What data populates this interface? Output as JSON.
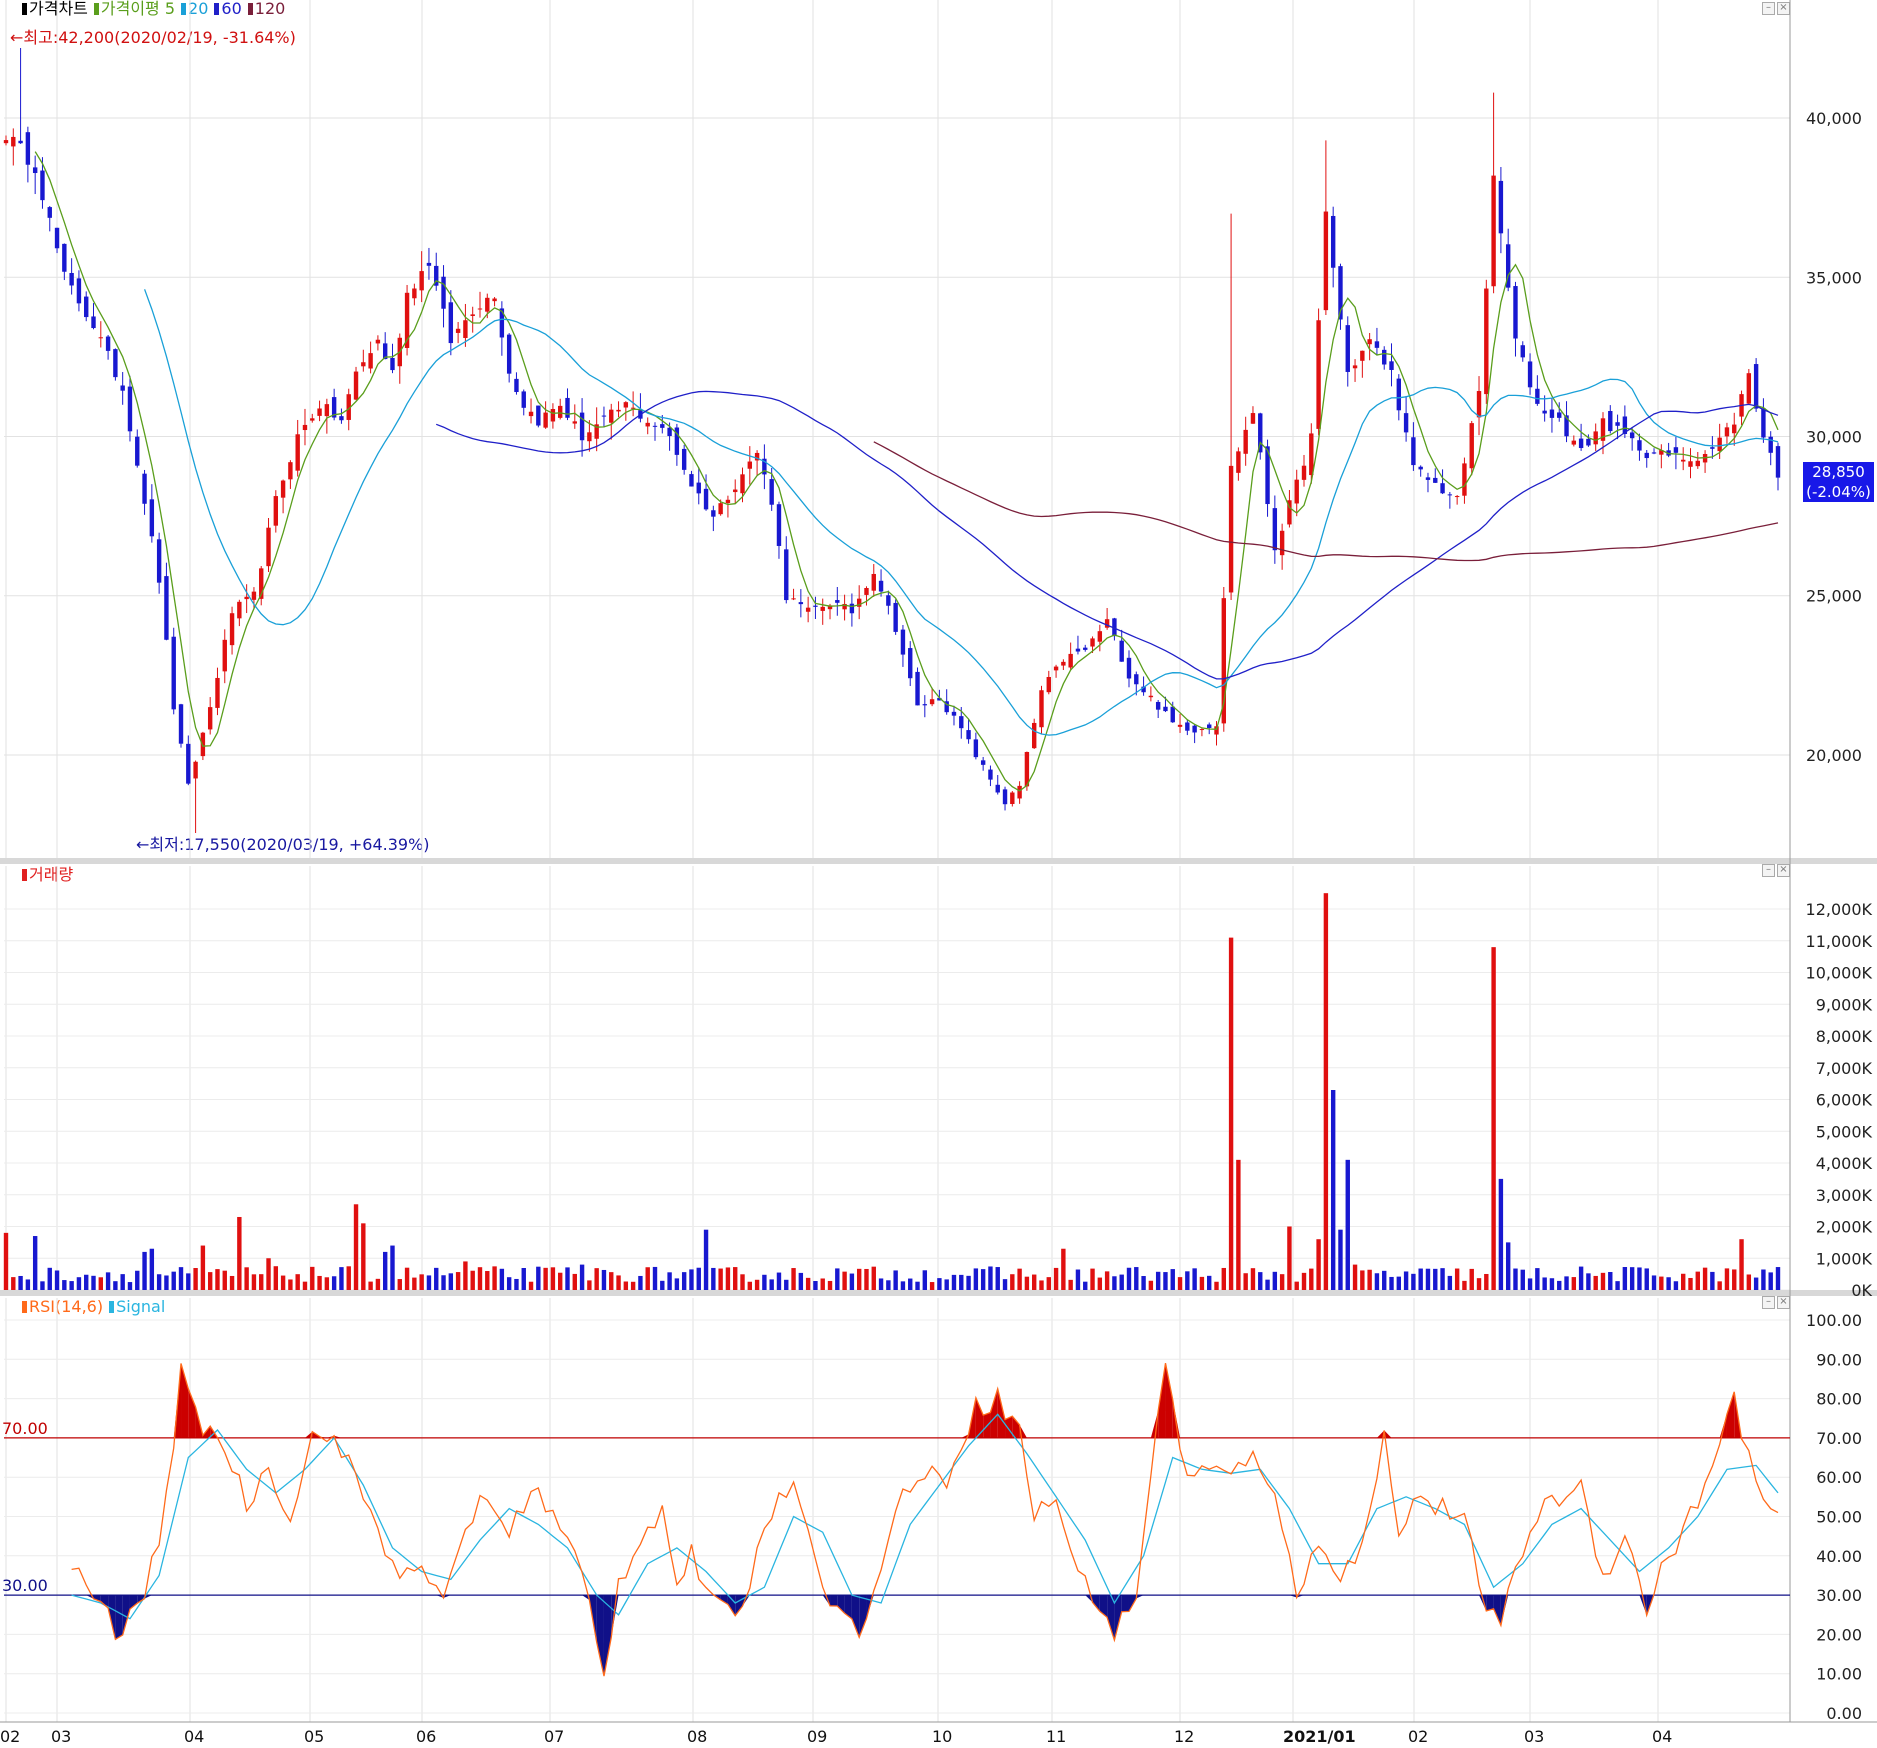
{
  "chart_data": [
    {
      "type": "candlestick",
      "panel": "price",
      "legend": [
        {
          "label": "가격차트",
          "color": "#000000"
        },
        {
          "label": "가격이평 5",
          "color": "#5a9e1c"
        },
        {
          "label": "20",
          "color": "#1aa0d8"
        },
        {
          "label": "60",
          "color": "#2020c8"
        },
        {
          "label": "120",
          "color": "#7a1f3a"
        }
      ],
      "high_note": "←최고:42,200(2020/02/19, -31.64%)",
      "low_note": "←최저:17,550(2020/03/19, +64.39%)",
      "current_price": "28,850",
      "current_change": "(-2.04%)",
      "y_ticks": [
        "40,000",
        "35,000",
        "30,000",
        "25,000",
        "20,000"
      ],
      "y_tick_values": [
        40000,
        35000,
        30000,
        25000,
        20000
      ],
      "ylim": [
        17000,
        42500
      ],
      "x_month_labels": [
        "02",
        "03",
        "04",
        "05",
        "06",
        "07",
        "08",
        "09",
        "10",
        "11",
        "12",
        "2021/01",
        "02",
        "03",
        "04"
      ],
      "close_anchors": [
        [
          0,
          39500
        ],
        [
          4,
          38500
        ],
        [
          8,
          35000
        ],
        [
          12,
          33500
        ],
        [
          16,
          31500
        ],
        [
          19,
          28000
        ],
        [
          21,
          25500
        ],
        [
          23,
          21500
        ],
        [
          25,
          19000
        ],
        [
          28,
          21500
        ],
        [
          31,
          24500
        ],
        [
          34,
          25000
        ],
        [
          37,
          28000
        ],
        [
          40,
          30000
        ],
        [
          43,
          31000
        ],
        [
          46,
          30500
        ],
        [
          48,
          32000
        ],
        [
          51,
          33000
        ],
        [
          53,
          32000
        ],
        [
          55,
          34500
        ],
        [
          58,
          35500
        ],
        [
          61,
          33000
        ],
        [
          64,
          34000
        ],
        [
          67,
          34500
        ],
        [
          69,
          32000
        ],
        [
          71,
          31000
        ],
        [
          73,
          30500
        ],
        [
          76,
          31000
        ],
        [
          79,
          30000
        ],
        [
          82,
          30500
        ],
        [
          85,
          31000
        ],
        [
          88,
          30500
        ],
        [
          91,
          30000
        ],
        [
          94,
          28500
        ],
        [
          97,
          27500
        ],
        [
          100,
          28500
        ],
        [
          103,
          29500
        ],
        [
          105,
          28000
        ],
        [
          107,
          25000
        ],
        [
          110,
          24500
        ],
        [
          113,
          24800
        ],
        [
          116,
          24500
        ],
        [
          119,
          25800
        ],
        [
          122,
          24000
        ],
        [
          125,
          21500
        ],
        [
          128,
          21800
        ],
        [
          131,
          20800
        ],
        [
          134,
          19600
        ],
        [
          137,
          18500
        ],
        [
          139,
          19000
        ],
        [
          142,
          22000
        ],
        [
          145,
          23000
        ],
        [
          148,
          23300
        ],
        [
          151,
          24200
        ],
        [
          154,
          22500
        ],
        [
          157,
          21800
        ],
        [
          160,
          21000
        ],
        [
          163,
          20800
        ],
        [
          166,
          21000
        ],
        [
          168,
          29000
        ],
        [
          171,
          30800
        ],
        [
          174,
          26500
        ],
        [
          177,
          28500
        ],
        [
          179,
          30000
        ],
        [
          181,
          37000
        ],
        [
          184,
          32000
        ],
        [
          187,
          33000
        ],
        [
          190,
          32000
        ],
        [
          193,
          29000
        ],
        [
          196,
          28500
        ],
        [
          199,
          28000
        ],
        [
          202,
          31500
        ],
        [
          204,
          38000
        ],
        [
          207,
          33000
        ],
        [
          210,
          31000
        ],
        [
          213,
          30500
        ],
        [
          216,
          29500
        ],
        [
          219,
          30500
        ],
        [
          222,
          30000
        ],
        [
          225,
          29500
        ],
        [
          228,
          29400
        ],
        [
          231,
          29300
        ],
        [
          234,
          29600
        ],
        [
          237,
          30500
        ],
        [
          239,
          32000
        ],
        [
          241,
          30000
        ],
        [
          243,
          28850
        ]
      ],
      "ma_periods": [
        5,
        20,
        60,
        120
      ]
    },
    {
      "type": "bar",
      "panel": "volume",
      "legend": [
        {
          "label": "거래량",
          "color": "#e02020"
        }
      ],
      "y_ticks": [
        "12,000K",
        "11,000K",
        "10,000K",
        "9,000K",
        "8,000K",
        "7,000K",
        "6,000K",
        "5,000K",
        "4,000K",
        "3,000K",
        "2,000K",
        "1,000K",
        "0K"
      ],
      "ylim": [
        0,
        12600
      ],
      "spikes": [
        [
          0,
          1800
        ],
        [
          4,
          1700
        ],
        [
          19,
          1200
        ],
        [
          20,
          1300
        ],
        [
          27,
          1400
        ],
        [
          32,
          2300
        ],
        [
          36,
          1000
        ],
        [
          48,
          2700
        ],
        [
          49,
          2100
        ],
        [
          52,
          1200
        ],
        [
          53,
          1400
        ],
        [
          63,
          900
        ],
        [
          79,
          800
        ],
        [
          96,
          1900
        ],
        [
          145,
          1300
        ],
        [
          168,
          11100
        ],
        [
          169,
          4100
        ],
        [
          176,
          2000
        ],
        [
          180,
          1600
        ],
        [
          181,
          12500
        ],
        [
          182,
          6300
        ],
        [
          183,
          1900
        ],
        [
          184,
          4100
        ],
        [
          185,
          800
        ],
        [
          204,
          10800
        ],
        [
          205,
          3500
        ],
        [
          206,
          1500
        ],
        [
          238,
          1600
        ]
      ]
    },
    {
      "type": "line",
      "panel": "rsi",
      "legend": [
        {
          "label": "RSI(14,6)",
          "color": "#ff6a1a"
        },
        {
          "label": "Signal",
          "color": "#2ab5e0"
        }
      ],
      "y_ticks": [
        "100.00",
        "90.00",
        "80.00",
        "70.00",
        "60.00",
        "50.00",
        "40.00",
        "30.00",
        "20.00",
        "10.00",
        "0.00"
      ],
      "ylim": [
        0,
        100
      ],
      "upper_level": "70.00",
      "lower_level": "30.00",
      "rsi_anchors": [
        [
          0,
          38
        ],
        [
          2,
          33
        ],
        [
          4,
          28
        ],
        [
          6,
          20
        ],
        [
          8,
          24
        ],
        [
          10,
          30
        ],
        [
          12,
          45
        ],
        [
          14,
          70
        ],
        [
          15,
          86
        ],
        [
          17,
          75
        ],
        [
          19,
          72
        ],
        [
          21,
          68
        ],
        [
          24,
          53
        ],
        [
          27,
          63
        ],
        [
          30,
          50
        ],
        [
          33,
          70
        ],
        [
          35,
          72
        ],
        [
          38,
          63
        ],
        [
          41,
          52
        ],
        [
          43,
          40
        ],
        [
          45,
          37
        ],
        [
          47,
          38
        ],
        [
          49,
          32
        ],
        [
          51,
          28
        ],
        [
          54,
          48
        ],
        [
          57,
          55
        ],
        [
          60,
          45
        ],
        [
          63,
          58
        ],
        [
          66,
          50
        ],
        [
          69,
          40
        ],
        [
          71,
          28
        ],
        [
          72,
          17
        ],
        [
          73,
          10
        ],
        [
          75,
          33
        ],
        [
          78,
          45
        ],
        [
          81,
          52
        ],
        [
          83,
          33
        ],
        [
          85,
          40
        ],
        [
          88,
          28
        ],
        [
          91,
          23
        ],
        [
          94,
          40
        ],
        [
          97,
          58
        ],
        [
          100,
          55
        ],
        [
          102,
          40
        ],
        [
          105,
          25
        ],
        [
          108,
          22
        ],
        [
          111,
          35
        ],
        [
          114,
          58
        ],
        [
          117,
          60
        ],
        [
          120,
          60
        ],
        [
          124,
          78
        ],
        [
          127,
          80
        ],
        [
          130,
          72
        ],
        [
          132,
          50
        ],
        [
          135,
          55
        ],
        [
          138,
          35
        ],
        [
          141,
          28
        ],
        [
          143,
          20
        ],
        [
          146,
          30
        ],
        [
          148,
          62
        ],
        [
          150,
          88
        ],
        [
          153,
          60
        ],
        [
          156,
          62
        ],
        [
          159,
          60
        ],
        [
          162,
          65
        ],
        [
          165,
          58
        ],
        [
          168,
          28
        ],
        [
          171,
          45
        ],
        [
          174,
          35
        ],
        [
          177,
          42
        ],
        [
          180,
          70
        ],
        [
          182,
          48
        ],
        [
          185,
          55
        ],
        [
          188,
          52
        ],
        [
          191,
          48
        ],
        [
          194,
          28
        ],
        [
          196,
          20
        ],
        [
          198,
          38
        ],
        [
          201,
          50
        ],
        [
          204,
          55
        ],
        [
          207,
          58
        ],
        [
          210,
          35
        ],
        [
          213,
          45
        ],
        [
          216,
          27
        ],
        [
          219,
          40
        ],
        [
          222,
          50
        ],
        [
          225,
          62
        ],
        [
          228,
          80
        ],
        [
          231,
          58
        ],
        [
          234,
          48
        ]
      ],
      "signal_anchors": [
        [
          0,
          30
        ],
        [
          4,
          28
        ],
        [
          8,
          24
        ],
        [
          12,
          35
        ],
        [
          16,
          65
        ],
        [
          20,
          72
        ],
        [
          24,
          62
        ],
        [
          28,
          56
        ],
        [
          32,
          62
        ],
        [
          36,
          70
        ],
        [
          40,
          58
        ],
        [
          44,
          42
        ],
        [
          48,
          36
        ],
        [
          52,
          34
        ],
        [
          56,
          44
        ],
        [
          60,
          52
        ],
        [
          64,
          48
        ],
        [
          68,
          42
        ],
        [
          72,
          30
        ],
        [
          75,
          25
        ],
        [
          79,
          38
        ],
        [
          83,
          42
        ],
        [
          87,
          36
        ],
        [
          91,
          28
        ],
        [
          95,
          32
        ],
        [
          99,
          50
        ],
        [
          103,
          46
        ],
        [
          107,
          30
        ],
        [
          111,
          28
        ],
        [
          115,
          48
        ],
        [
          119,
          58
        ],
        [
          123,
          68
        ],
        [
          127,
          76
        ],
        [
          131,
          66
        ],
        [
          135,
          55
        ],
        [
          139,
          44
        ],
        [
          143,
          28
        ],
        [
          147,
          40
        ],
        [
          151,
          65
        ],
        [
          155,
          62
        ],
        [
          159,
          61
        ],
        [
          163,
          62
        ],
        [
          167,
          52
        ],
        [
          171,
          38
        ],
        [
          175,
          38
        ],
        [
          179,
          52
        ],
        [
          183,
          55
        ],
        [
          187,
          52
        ],
        [
          191,
          48
        ],
        [
          195,
          32
        ],
        [
          199,
          38
        ],
        [
          203,
          48
        ],
        [
          207,
          52
        ],
        [
          211,
          44
        ],
        [
          215,
          36
        ],
        [
          219,
          42
        ],
        [
          223,
          50
        ],
        [
          227,
          62
        ],
        [
          231,
          63
        ],
        [
          234,
          56
        ]
      ]
    }
  ]
}
